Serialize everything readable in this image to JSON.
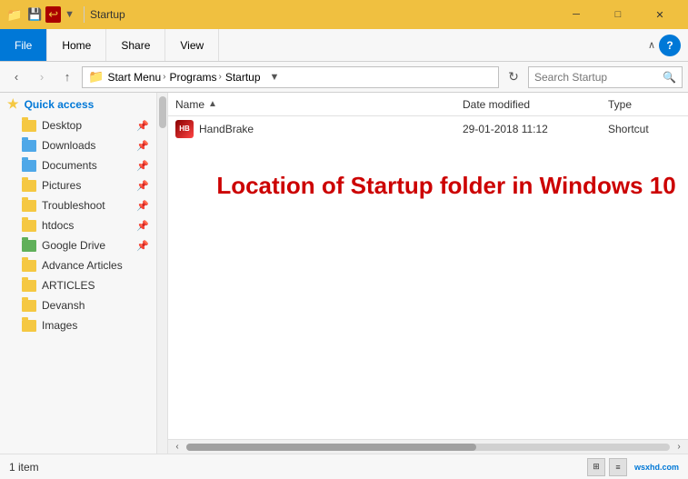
{
  "window": {
    "title": "Startup",
    "title_icon": "📁"
  },
  "titlebar": {
    "quick_access_icons": [
      "save",
      "undo"
    ],
    "controls": {
      "minimize": "─",
      "maximize": "□",
      "close": "✕"
    }
  },
  "ribbon": {
    "tabs": [
      {
        "label": "File",
        "active": true
      },
      {
        "label": "Home",
        "active": false
      },
      {
        "label": "Share",
        "active": false
      },
      {
        "label": "View",
        "active": false
      }
    ],
    "chevron_label": "∧",
    "help_label": "?"
  },
  "addressbar": {
    "back_disabled": false,
    "forward_disabled": true,
    "up_label": "↑",
    "path_parts": [
      "Start Menu",
      "Programs",
      "Startup"
    ],
    "refresh_label": "↻",
    "search_placeholder": "Search Startup",
    "search_icon": "🔍"
  },
  "sidebar": {
    "sections": [
      {
        "items": [
          {
            "label": "Quick access",
            "icon": "star",
            "type": "header",
            "active": false
          },
          {
            "label": "Desktop",
            "icon": "folder",
            "pinned": true
          },
          {
            "label": "Downloads",
            "icon": "folder-blue",
            "pinned": true
          },
          {
            "label": "Documents",
            "icon": "folder-blue",
            "pinned": true
          },
          {
            "label": "Pictures",
            "icon": "folder",
            "pinned": true
          },
          {
            "label": "Troubleshoot",
            "icon": "folder",
            "pinned": true
          },
          {
            "label": "htdocs",
            "icon": "folder",
            "pinned": true
          },
          {
            "label": "Google Drive",
            "icon": "folder-green",
            "pinned": true
          },
          {
            "label": "Advance Articles",
            "icon": "folder",
            "pinned": false
          },
          {
            "label": "ARTICLES",
            "icon": "folder",
            "pinned": false
          },
          {
            "label": "Devansh",
            "icon": "folder",
            "pinned": false
          },
          {
            "label": "Images",
            "icon": "folder",
            "pinned": false
          }
        ]
      }
    ]
  },
  "content": {
    "columns": [
      {
        "label": "Name",
        "sort_arrow": "▲"
      },
      {
        "label": "Date modified"
      },
      {
        "label": "Type"
      }
    ],
    "files": [
      {
        "name": "HandBrake",
        "icon": "hb",
        "date": "29-01-2018 11:12",
        "type": "Shortcut"
      }
    ],
    "overlay_text": "Location of Startup folder in Windows 10"
  },
  "statusbar": {
    "count": "1 item",
    "view_icons": [
      "grid",
      "list"
    ]
  },
  "watermark": "wsxhd.com"
}
